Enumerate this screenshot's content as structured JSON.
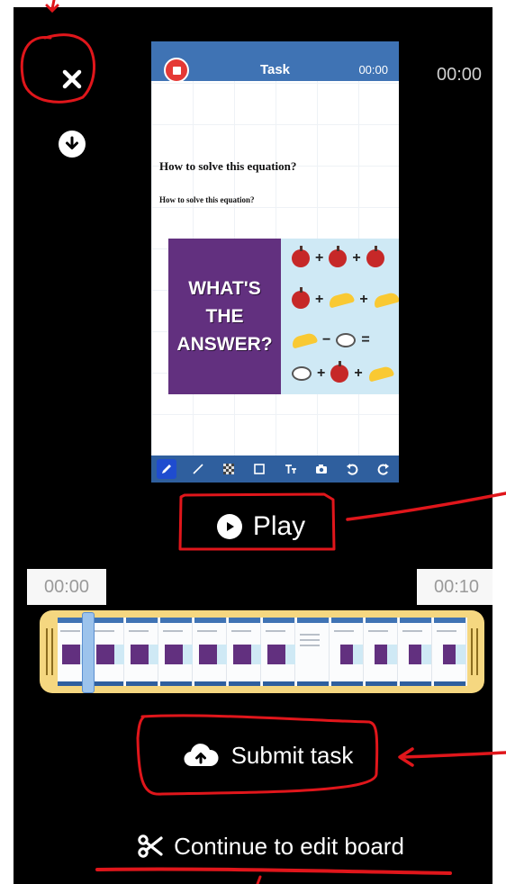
{
  "header": {
    "recording_time": "00:00"
  },
  "preview": {
    "title": "Task",
    "timer": "00:00",
    "question_title": "How to solve this equation?",
    "question_subtitle": "How to solve this equation?",
    "puzzle_text": [
      "WHAT'S",
      "THE",
      "ANSWER?"
    ],
    "toolbar": [
      "pen",
      "line",
      "pattern",
      "rectangle",
      "text",
      "camera",
      "undo",
      "redo"
    ]
  },
  "player": {
    "play_label": "Play"
  },
  "trim": {
    "start_time": "00:00",
    "end_time": "00:10",
    "playhead_fraction": 0.06
  },
  "actions": {
    "submit_label": "Submit task",
    "continue_label": "Continue to edit board"
  },
  "colors": {
    "header_blue": "#3f73b4",
    "trim_yellow": "#f5d780",
    "annotation_red": "#e0161b",
    "stop_red": "#e53935"
  }
}
